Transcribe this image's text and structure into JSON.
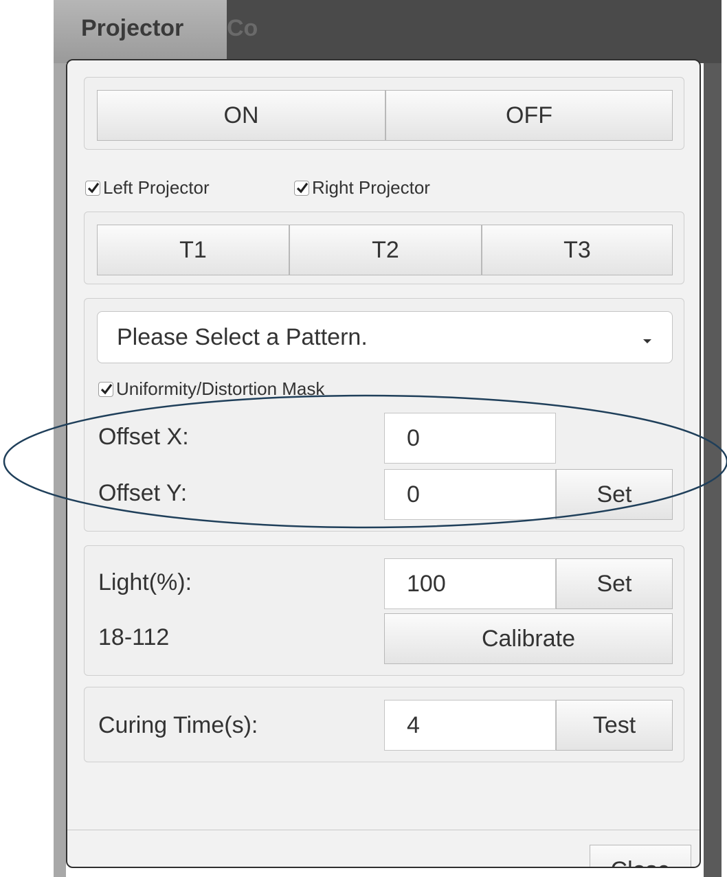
{
  "window": {
    "title": "Projector Control",
    "title_visible": "Projector",
    "title_faded": "Co"
  },
  "power": {
    "on_label": "ON",
    "off_label": "OFF"
  },
  "projectors": {
    "left_label": "Left Projector",
    "left_checked": true,
    "right_label": "Right Projector",
    "right_checked": true
  },
  "tests": {
    "t1_label": "T1",
    "t2_label": "T2",
    "t3_label": "T3"
  },
  "pattern": {
    "selected": "Please Select a Pattern.",
    "mask_label": "Uniformity/Distortion Mask",
    "mask_checked": true,
    "offset_x_label": "Offset X:",
    "offset_x_value": "0",
    "offset_y_label": "Offset Y:",
    "offset_y_value": "0",
    "set_label": "Set"
  },
  "light": {
    "label": "Light(%):",
    "value": "100",
    "set_label": "Set",
    "range": "18-112",
    "calibrate_label": "Calibrate"
  },
  "curing": {
    "label": "Curing Time(s):",
    "value": "4",
    "test_label": "Test"
  },
  "footer": {
    "close_label": "Close"
  },
  "colors": {
    "highlight_ellipse": "#1f3f5a"
  }
}
